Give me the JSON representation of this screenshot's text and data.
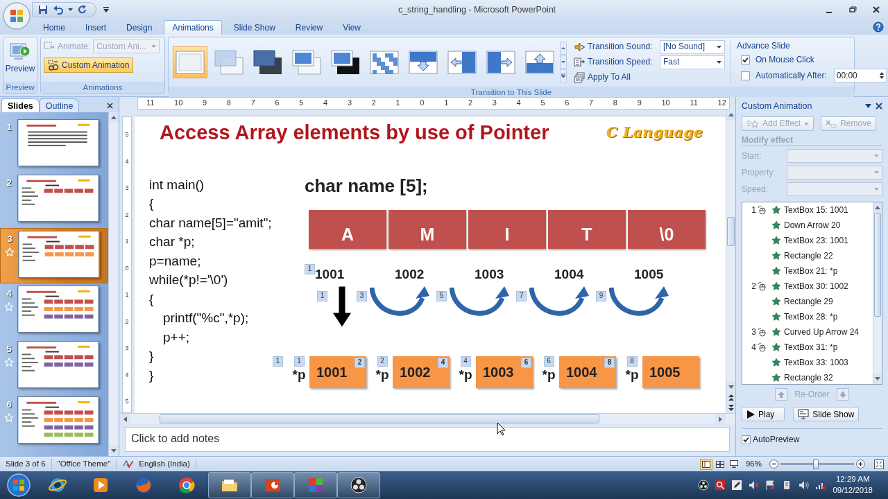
{
  "window": {
    "title": "c_string_handling - Microsoft PowerPoint"
  },
  "ribbon_tabs": [
    {
      "label": "Home",
      "selected": false
    },
    {
      "label": "Insert",
      "selected": false
    },
    {
      "label": "Design",
      "selected": false
    },
    {
      "label": "Animations",
      "selected": true
    },
    {
      "label": "Slide Show",
      "selected": false
    },
    {
      "label": "Review",
      "selected": false
    },
    {
      "label": "View",
      "selected": false
    }
  ],
  "preview_group": {
    "button": "Preview",
    "label": "Preview"
  },
  "animations_group": {
    "animate_label": "Animate:",
    "animate_value": "Custom Ani...",
    "animate_disabled": true,
    "custom_animation": {
      "label": "Custom Animation",
      "highlighted": true
    },
    "label": "Animations"
  },
  "transition_group": {
    "gallery": [
      {
        "kind": "plain",
        "selected": true
      },
      {
        "kind": "fade",
        "selected": false
      },
      {
        "kind": "fade-dark",
        "selected": false
      },
      {
        "kind": "cut",
        "selected": false
      },
      {
        "kind": "cut-dark",
        "selected": false
      },
      {
        "kind": "dissolve",
        "selected": false
      },
      {
        "kind": "wipe-down",
        "selected": false
      },
      {
        "kind": "wipe-left",
        "selected": false
      },
      {
        "kind": "wipe-right",
        "selected": false
      },
      {
        "kind": "wipe-up",
        "selected": false
      }
    ],
    "sound_label": "Transition Sound:",
    "sound_value": "[No Sound]",
    "speed_label": "Transition Speed:",
    "speed_value": "Fast",
    "apply_all": "Apply To All",
    "label": "Transition to This Slide"
  },
  "advance_slide": {
    "title": "Advance Slide",
    "on_mouse_click": {
      "label": "On Mouse Click",
      "checked": true
    },
    "automatically_after": {
      "label": "Automatically After:",
      "checked": false,
      "value": "00:00"
    }
  },
  "slides_pane": {
    "tabs": [
      {
        "label": "Slides",
        "selected": true
      },
      {
        "label": "Outline",
        "selected": false
      }
    ],
    "slides": [
      {
        "number": "1",
        "animated": false,
        "selected": false
      },
      {
        "number": "2",
        "animated": false,
        "selected": false
      },
      {
        "number": "3",
        "animated": true,
        "selected": true
      },
      {
        "number": "4",
        "animated": true,
        "selected": false
      },
      {
        "number": "5",
        "animated": true,
        "selected": false
      },
      {
        "number": "6",
        "animated": true,
        "selected": false
      }
    ]
  },
  "rulers": {
    "horizontal": [
      "11",
      "10",
      "9",
      "8",
      "7",
      "6",
      "5",
      "4",
      "3",
      "2",
      "1",
      "0",
      "1",
      "2",
      "3",
      "4",
      "5",
      "6",
      "7",
      "8",
      "9",
      "10",
      "11",
      "12"
    ],
    "vertical": [
      "5",
      "4",
      "3",
      "2",
      "1",
      "0",
      "1",
      "2",
      "3",
      "4",
      "5"
    ]
  },
  "slide": {
    "title": "Access Array elements by use of Pointer",
    "logo": "C Language",
    "code": [
      {
        "text": "int main()"
      },
      {
        "text": "{"
      },
      {
        "text": "char name[5]=\"amit\";"
      },
      {
        "text": "char *p;"
      },
      {
        "text": "p=name;"
      },
      {
        "text": "while(*p!='\\0')"
      },
      {
        "text": "{",
        "children": [
          {
            "text": "printf(\"%c\",*p);"
          },
          {
            "text": "p++;"
          }
        ]
      },
      {
        "text": "}"
      },
      {
        "text": "}"
      }
    ],
    "declaration": "char name [5];",
    "array_cells": [
      "A",
      "M",
      "I",
      "T",
      "\\0"
    ],
    "address_tag": "1",
    "addresses": [
      "1001",
      "1002",
      "1003",
      "1004",
      "1005"
    ],
    "down_arrow_tag": "1",
    "curve_tags": [
      "3",
      "5",
      "7",
      "9"
    ],
    "pointer_lead_tag": "1",
    "pointers": [
      {
        "label": "*p",
        "label_tag": "1",
        "value": "1001",
        "value_tag": "2"
      },
      {
        "label": "*p",
        "label_tag": "2",
        "value": "1002",
        "value_tag": "4"
      },
      {
        "label": "*p",
        "label_tag": "4",
        "value": "1003",
        "value_tag": "6"
      },
      {
        "label": "*p",
        "label_tag": "6",
        "value": "1004",
        "value_tag": "8"
      },
      {
        "label": "*p",
        "label_tag": "8",
        "value": "1005"
      }
    ]
  },
  "notes": {
    "placeholder": "Click to add notes"
  },
  "custom_animation": {
    "title": "Custom Animation",
    "add_effect": {
      "label": "Add Effect",
      "disabled": true
    },
    "remove": {
      "label": "Remove",
      "disabled": true
    },
    "modify_title": "Modify effect",
    "fields": [
      {
        "label": "Start:",
        "disabled": true
      },
      {
        "label": "Property:",
        "disabled": true
      },
      {
        "label": "Speed:",
        "disabled": true
      }
    ],
    "effects": [
      {
        "order": "1",
        "label": "TextBox 15: 1001"
      },
      {
        "label": "Down Arrow 20"
      },
      {
        "label": "TextBox 23: 1001"
      },
      {
        "label": "Rectangle 22"
      },
      {
        "label": "TextBox 21: *p"
      },
      {
        "order": "2",
        "label": "TextBox 30: 1002"
      },
      {
        "label": "Rectangle 29"
      },
      {
        "label": "TextBox 28: *p"
      },
      {
        "order": "3",
        "label": "Curved Up Arrow 24"
      },
      {
        "order": "4",
        "label": "TextBox 31: *p"
      },
      {
        "label": "TextBox 33: 1003"
      },
      {
        "label": "Rectangle 32"
      }
    ],
    "reorder": "Re-Order",
    "play": "Play",
    "slide_show": "Slide Show",
    "autopreview": {
      "label": "AutoPreview",
      "checked": true
    }
  },
  "status_bar": {
    "slide_info": "Slide 3 of 6",
    "theme": "\"Office Theme\"",
    "language": "English (India)",
    "views": [
      {
        "kind": "normal",
        "selected": true
      },
      {
        "kind": "sorter",
        "selected": false
      },
      {
        "kind": "show",
        "selected": false
      }
    ],
    "zoom": "96%",
    "zoom_slider": {
      "level": 0.48
    }
  },
  "taskbar": {
    "apps": [
      {
        "kind": "globe-e",
        "active": false
      },
      {
        "kind": "media",
        "active": false
      },
      {
        "kind": "fox",
        "active": false
      },
      {
        "kind": "tricolor",
        "active": false
      },
      {
        "kind": "folder",
        "active": true
      },
      {
        "kind": "presentation",
        "active": true
      },
      {
        "kind": "squares",
        "active": true
      },
      {
        "kind": "recorder",
        "active": true
      }
    ],
    "time": "12:29 AM",
    "date": "09/12/2018"
  }
}
